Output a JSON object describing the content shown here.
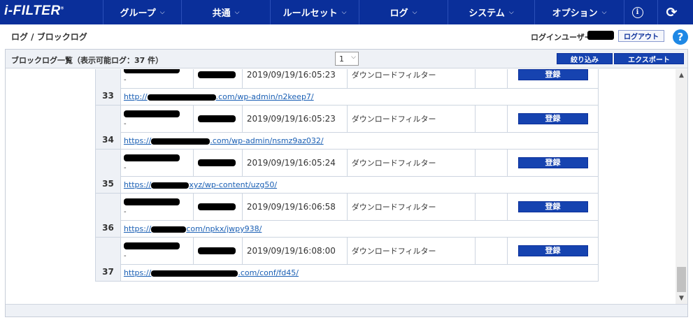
{
  "header": {
    "logo": "i-FILTER",
    "logo_mark": "®",
    "menus": [
      {
        "label": "グループ"
      },
      {
        "label": "共通"
      },
      {
        "label": "ルールセット"
      },
      {
        "label": "ログ"
      },
      {
        "label": "システム"
      },
      {
        "label": "オプション"
      }
    ],
    "chevron": "⌵",
    "info_glyph": "i",
    "refresh_glyph": "⟳"
  },
  "breadcrumb": "ログ / ブロックログ",
  "user": {
    "label": "ログインユーザー:",
    "logout": "ログアウト",
    "help": "?"
  },
  "panel": {
    "title": "ブロックログ一覧（表示可能ログ：37 件）",
    "page_selected": "1",
    "page_dd": "⌵",
    "filter_button": "絞り込み",
    "export_button": "エクスポート"
  },
  "scroll": {
    "up": "▲",
    "down": "▼"
  },
  "rows": [
    {
      "num": "33",
      "sub": "-",
      "datetime": "2019/09/19/16:05:23",
      "filter": "ダウンロードフィルター",
      "button": "登録",
      "url_prefix": "http://",
      "url_suffix": ".com/wp-admin/n2keep7/"
    },
    {
      "num": "34",
      "sub": "-",
      "datetime": "2019/09/19/16:05:23",
      "filter": "ダウンロードフィルター",
      "button": "登録",
      "url_prefix": "https://",
      "url_suffix": ".com/wp-admin/nsmz9az032/"
    },
    {
      "num": "35",
      "sub": "-",
      "datetime": "2019/09/19/16:05:24",
      "filter": "ダウンロードフィルター",
      "button": "登録",
      "url_prefix": "https://",
      "url_suffix": "xyz/wp-content/uzg50/"
    },
    {
      "num": "36",
      "sub": "-",
      "datetime": "2019/09/19/16:06:58",
      "filter": "ダウンロードフィルター",
      "button": "登録",
      "url_prefix": "https://",
      "url_suffix": "com/npkx/jwpy938/"
    },
    {
      "num": "37",
      "sub": "-",
      "datetime": "2019/09/19/16:08:00",
      "filter": "ダウンロードフィルター",
      "button": "登録",
      "url_prefix": "https://",
      "url_suffix": ".com/conf/fd45/"
    }
  ],
  "colors": {
    "nav_bg": "#0a2f9a",
    "button_bg": "#1643b0",
    "link": "#1a5fb4",
    "help": "#1e88e5"
  }
}
